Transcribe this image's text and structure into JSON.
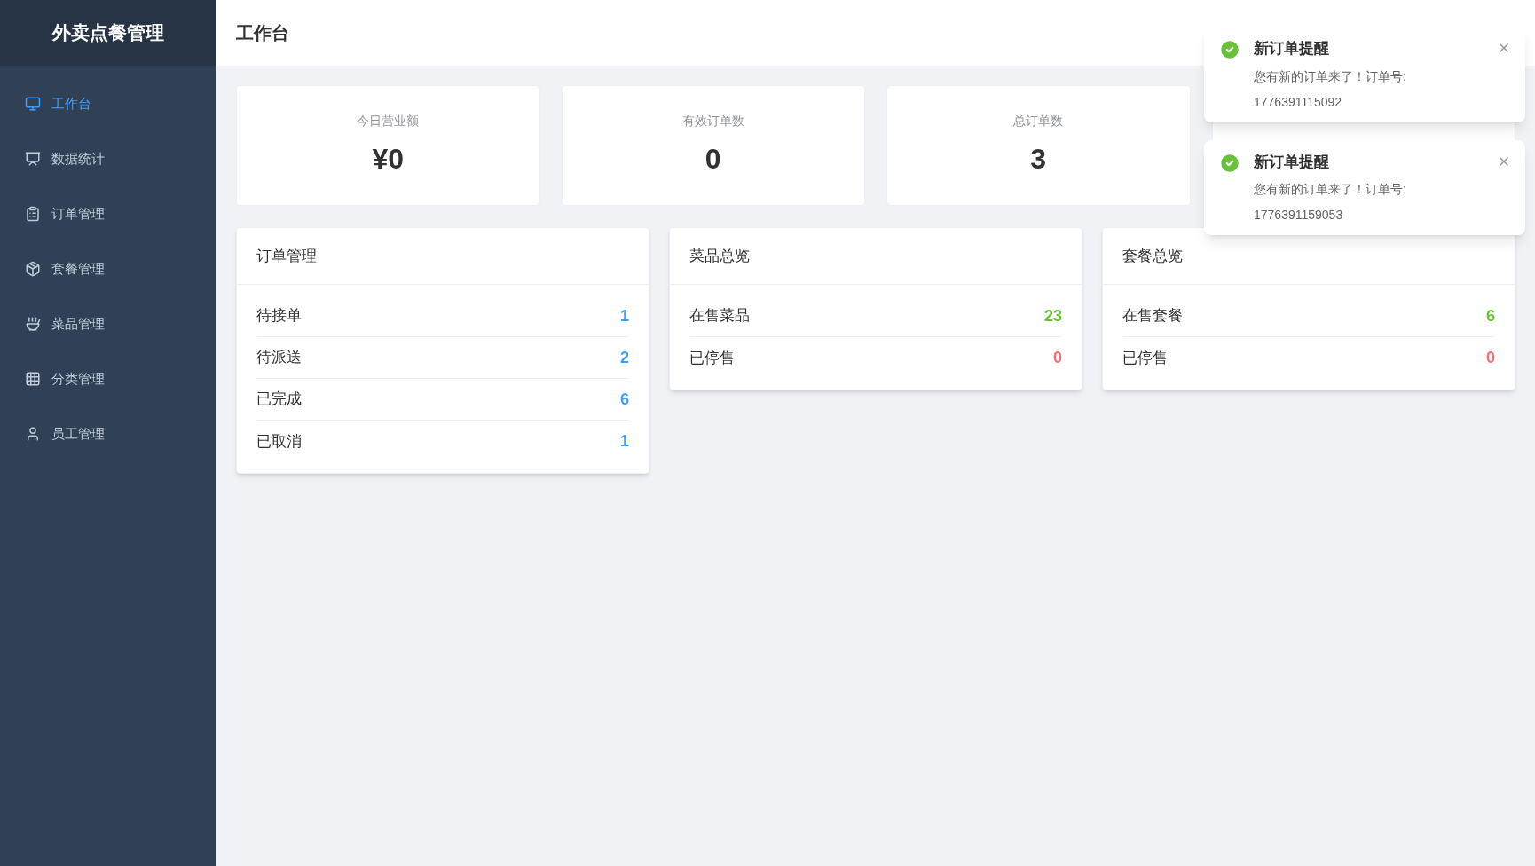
{
  "sidebar": {
    "title": "外卖点餐管理",
    "items": [
      {
        "label": "工作台",
        "kind": "monitor",
        "selected": true
      },
      {
        "label": "数据统计",
        "kind": "chart",
        "selected": false
      },
      {
        "label": "订单管理",
        "kind": "clipboard",
        "selected": false
      },
      {
        "label": "套餐管理",
        "kind": "package",
        "selected": false
      },
      {
        "label": "菜品管理",
        "kind": "bowl",
        "selected": false
      },
      {
        "label": "分类管理",
        "kind": "grid",
        "selected": false
      },
      {
        "label": "员工管理",
        "kind": "user",
        "selected": false
      }
    ]
  },
  "header": {
    "title": "工作台"
  },
  "stats": [
    {
      "label": "今日营业额",
      "value": "¥0"
    },
    {
      "label": "有效订单数",
      "value": "0"
    },
    {
      "label": "总订单数",
      "value": "3"
    }
  ],
  "panels": [
    {
      "title": "订单管理",
      "rows": [
        {
          "label": "待接单",
          "value": "1",
          "color": "#409eff"
        },
        {
          "label": "待派送",
          "value": "2",
          "color": "#409eff"
        },
        {
          "label": "已完成",
          "value": "6",
          "color": "#409eff"
        },
        {
          "label": "已取消",
          "value": "1",
          "color": "#409eff"
        }
      ]
    },
    {
      "title": "菜品总览",
      "rows": [
        {
          "label": "在售菜品",
          "value": "23",
          "color": "#67c23a"
        },
        {
          "label": "已停售",
          "value": "0",
          "color": "#f56c6c"
        }
      ]
    },
    {
      "title": "套餐总览",
      "rows": [
        {
          "label": "在售套餐",
          "value": "6",
          "color": "#67c23a"
        },
        {
          "label": "已停售",
          "value": "0",
          "color": "#f56c6c"
        }
      ]
    }
  ],
  "notifications": [
    {
      "title": "新订单提醒",
      "message": "您有新的订单来了！订单号:",
      "order": "1776391115092"
    },
    {
      "title": "新订单提醒",
      "message": "您有新的订单来了！订单号:",
      "order": "1776391159053"
    }
  ]
}
